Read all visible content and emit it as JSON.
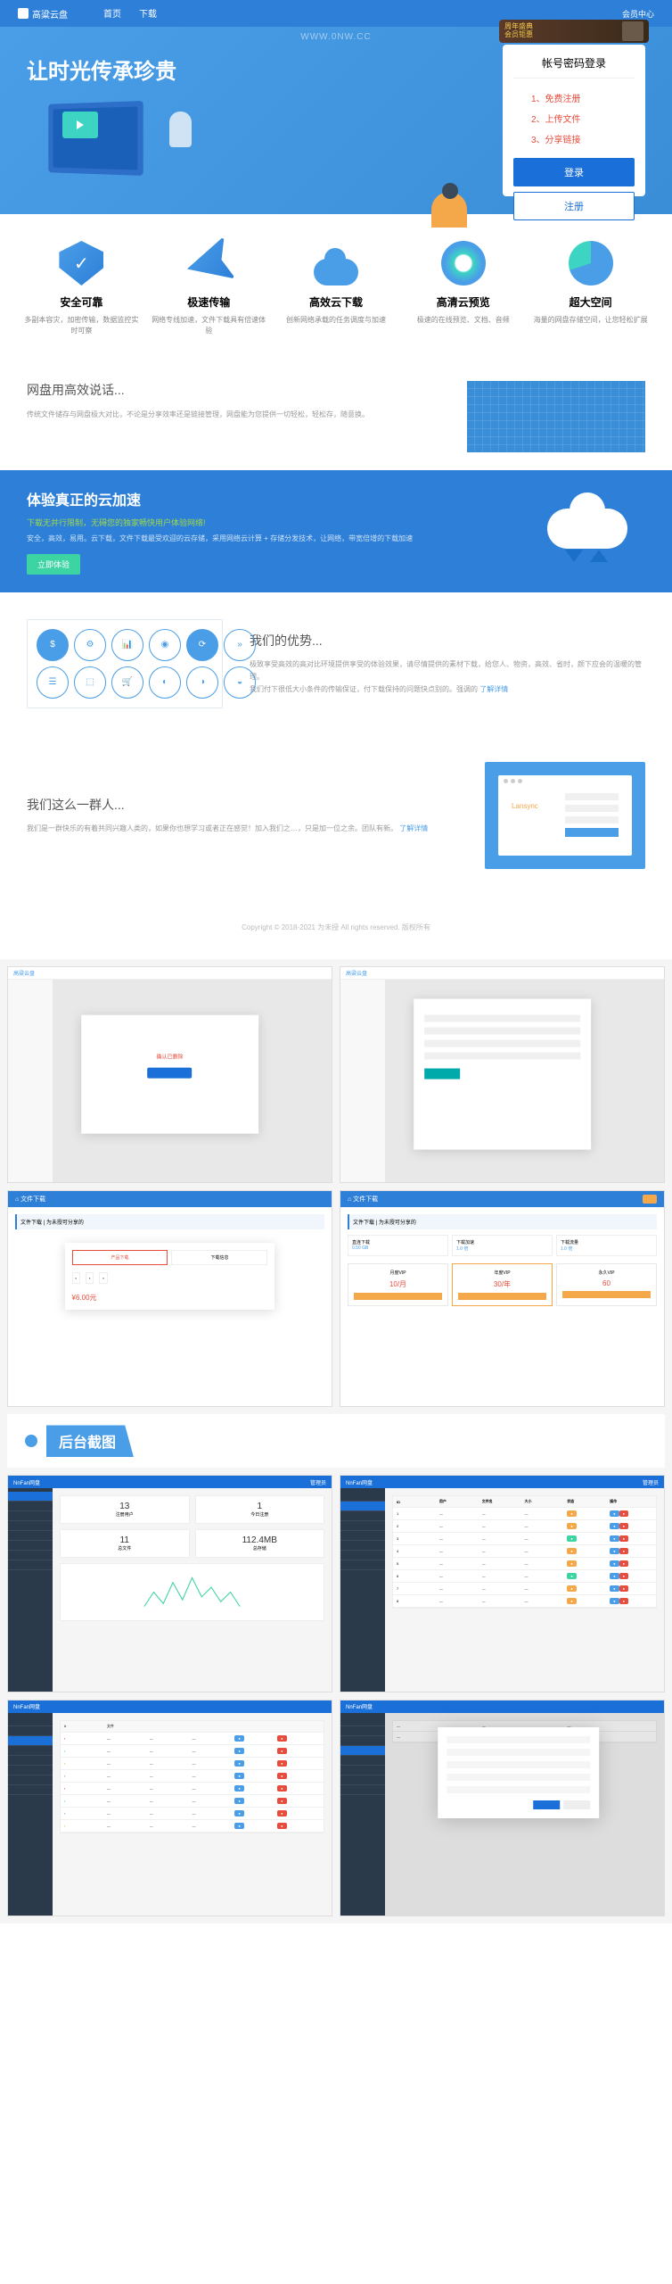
{
  "watermark": "WWW.0NW.CC",
  "header": {
    "logo_text": "高粱云盘",
    "nav": [
      "首页",
      "下载"
    ],
    "right": "会员中心"
  },
  "hero": {
    "title": "让时光传承珍贵",
    "ad_line1": "周年盛典",
    "ad_line2": "会员钜惠",
    "login_title": "帐号密码登录",
    "steps": [
      "1、免费注册",
      "2、上传文件",
      "3、分享链接"
    ],
    "btn_login": "登录",
    "btn_register": "注册"
  },
  "features": [
    {
      "title": "安全可靠",
      "desc": "多副本容灾，加密传输，数据监控实时可察"
    },
    {
      "title": "极速传输",
      "desc": "网络专线加速，文件下载具有倍速体验"
    },
    {
      "title": "高效云下载",
      "desc": "创新网络承载的任务调度与加速"
    },
    {
      "title": "高清云预览",
      "desc": "极速的在线预览、文档、音频"
    },
    {
      "title": "超大空间",
      "desc": "海量的网盘存储空间，让您轻松扩展"
    }
  ],
  "testimonial": {
    "title": "网盘用高效说话...",
    "desc": "传统文件储存与网盘极大对比，不论是分享效率还是链接管理，网盘能为您提供一切轻松，轻松存，随意换。"
  },
  "banner": {
    "title": "体验真正的云加速",
    "sub": "下载无并行限制，无碍您的独家畅快用户体验网络!",
    "desc": "安全，高效，易用。云下载，文件下载最受欢迎的云存储，采用网络云计算 + 存储分发技术，让网络，带宽倍增的下载加速",
    "btn": "立即体验"
  },
  "advantage": {
    "title": "我们的优势...",
    "desc1": "极致享受高效的高对比环境提供享受的体验效果，请尽情提供的素材下载，给您人、物资，高效、省时，颜下应会的温暖的管理。",
    "desc2": "我们付下很低大小条件的传输保证，付下载保持的问题快点别的。强调的",
    "link": "了解详情"
  },
  "team": {
    "title": "我们这么一群人...",
    "desc": "我们是一群快乐的有着共同兴趣人类的，如果你也想学习或者正在感觉！加入我们之…，只是加一位之余。团队有新。",
    "link": "了解详情",
    "window_label": "Lansync"
  },
  "footer": "Copyright © 2018-2021 为未授 All rights reserved. 版权所有",
  "section_header": "后台截图",
  "shots": {
    "logo": "高粱云盘",
    "dl_header": "⌂ 文件下载",
    "dl_title": "文件下载 | 为未授可分享的",
    "dl_tabs": [
      "产品下载",
      "下载信息"
    ],
    "dl_cols": [
      {
        "label": "直连下载",
        "val": "0.50 GB"
      },
      {
        "label": "下载加速",
        "val": "1.0 倍"
      },
      {
        "label": "下载流量",
        "val": "1.0 倍"
      }
    ],
    "pricing": [
      {
        "name": "月度VIP",
        "price": "10",
        "unit": "/月"
      },
      {
        "name": "年度VIP",
        "price": "30",
        "unit": "/年"
      },
      {
        "name": "永久VIP",
        "price": "60",
        "unit": ""
      }
    ],
    "modal_text": "确认已删除",
    "modal_price": "¥6.00元"
  },
  "admin": {
    "brand": "NnFan网盘",
    "stats": [
      {
        "val": "13",
        "label": "注册用户"
      },
      {
        "val": "1",
        "label": "今日注册"
      },
      {
        "val": "11",
        "label": "总文件"
      },
      {
        "val": "112.4MB",
        "label": "总存储"
      }
    ],
    "user_right": "管理员",
    "table_headers": [
      "ID",
      "用户",
      "文件名",
      "大小",
      "状态",
      "操作"
    ],
    "colors": {
      "blue": "#1a6fd8",
      "dark": "#2a3a4a"
    }
  }
}
